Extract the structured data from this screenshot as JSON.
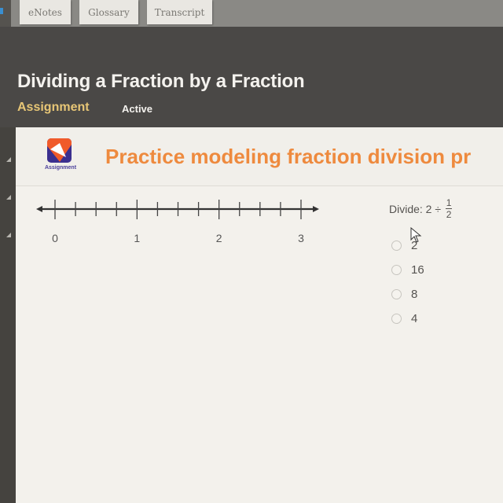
{
  "tabs": [
    {
      "label": "eNotes"
    },
    {
      "label": "Glossary"
    },
    {
      "label": "Transcript"
    }
  ],
  "header": {
    "title": "Dividing a Fraction by a Fraction",
    "type_label": "Assignment",
    "status": "Active"
  },
  "content": {
    "logo_caption": "Assignment",
    "title": "Practice modeling fraction division pr",
    "number_line": {
      "min": 0,
      "max": 3,
      "labels": [
        "0",
        "1",
        "2",
        "3"
      ],
      "subdivisions_per_unit": 4
    },
    "question": {
      "prefix": "Divide: 2 ÷",
      "fraction_numerator": "1",
      "fraction_denominator": "2"
    },
    "options": [
      {
        "label": "2"
      },
      {
        "label": "16"
      },
      {
        "label": "8"
      },
      {
        "label": "4"
      }
    ]
  },
  "colors": {
    "title_orange": "#ee8a3e",
    "assignment_gold": "#e7c676",
    "logo_purple": "#3b2f8f",
    "logo_red": "#f05a2a"
  }
}
